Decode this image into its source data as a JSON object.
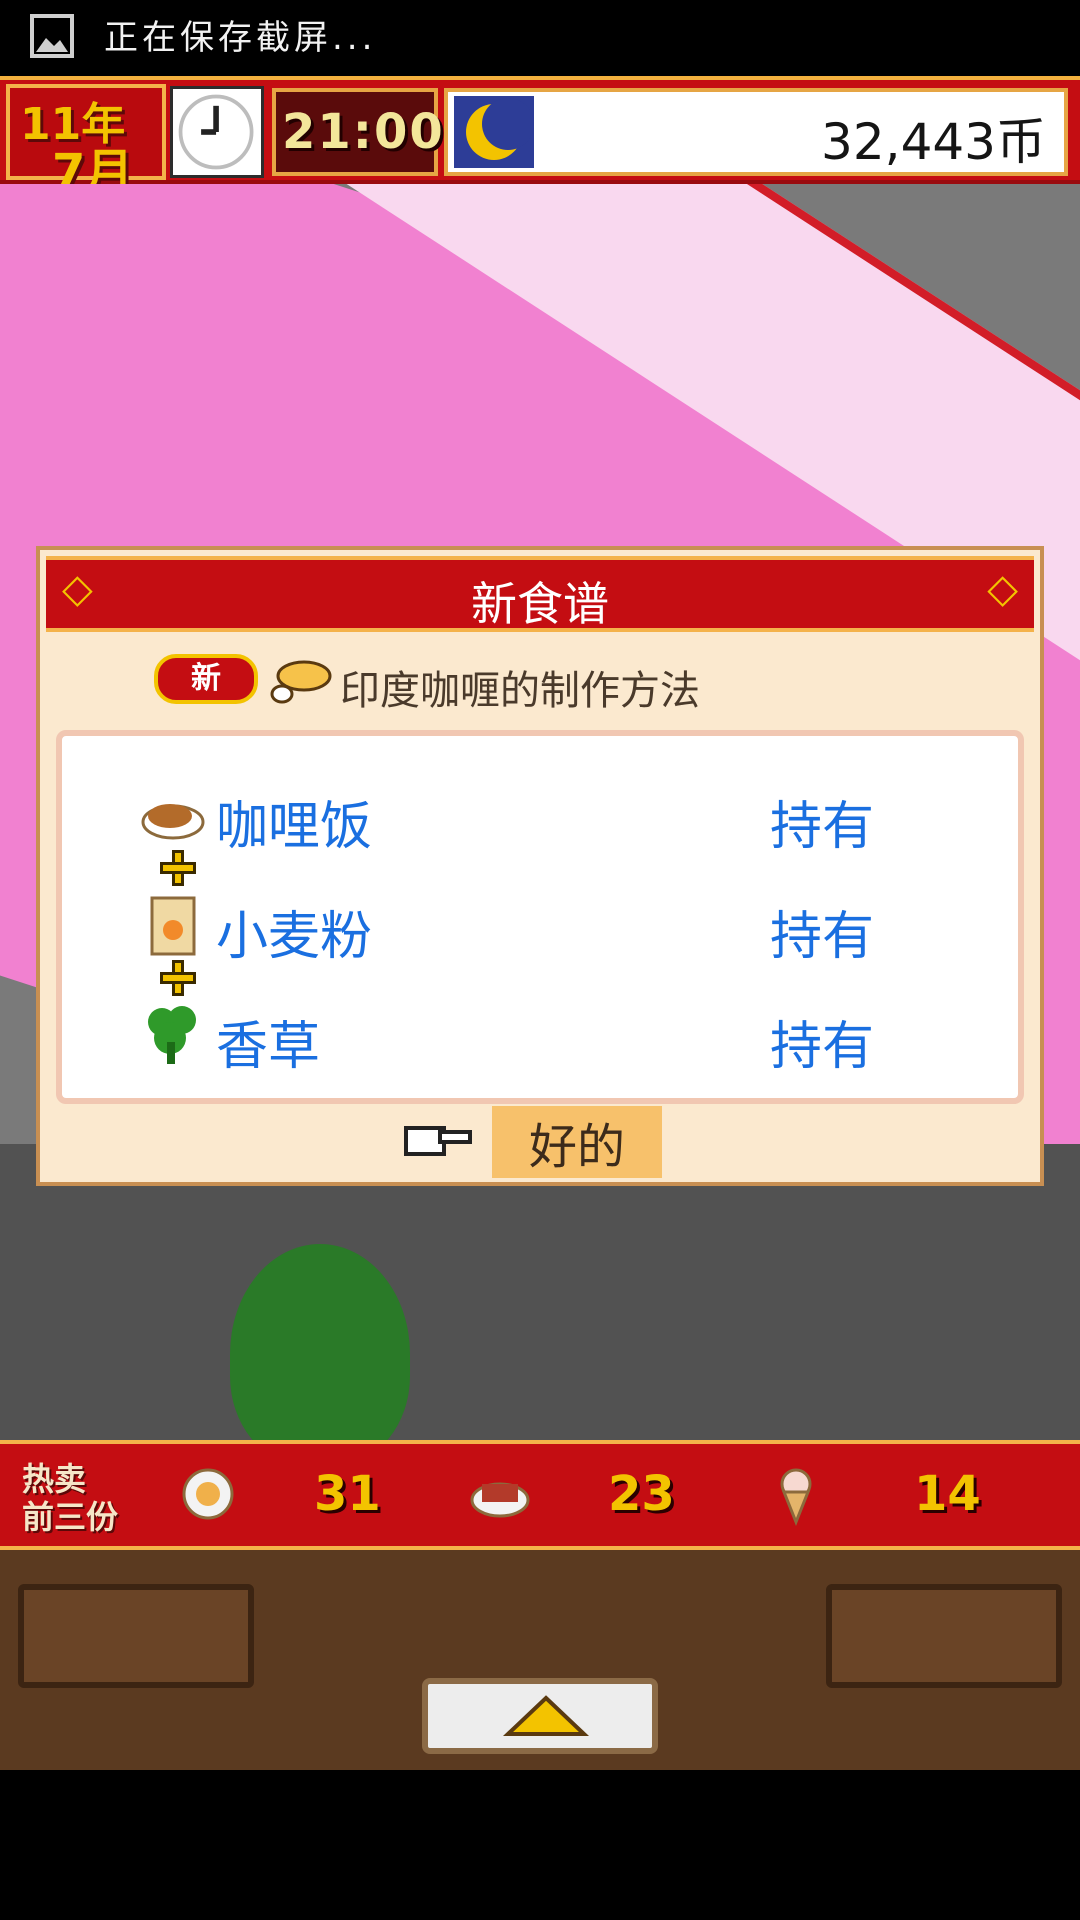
{
  "status_bar": {
    "text": "正在保存截屏..."
  },
  "hud": {
    "year": "11年",
    "month": "7月",
    "time": "21:00",
    "money": "32,443币"
  },
  "dialog": {
    "title": "新食谱",
    "badge": "新",
    "recipe": "印度咖喱的制作方法",
    "items": [
      {
        "name": "咖哩饭",
        "status": "持有",
        "icon": "curry-rice-icon"
      },
      {
        "name": "小麦粉",
        "status": "持有",
        "icon": "flour-bag-icon"
      },
      {
        "name": "香草",
        "status": "持有",
        "icon": "herb-icon"
      }
    ],
    "ok": "好的"
  },
  "ranking": {
    "title_line1": "热卖",
    "title_line2": "前三份",
    "items": [
      {
        "icon": "plate-dish-icon",
        "count": "31"
      },
      {
        "icon": "bbq-dish-icon",
        "count": "23"
      },
      {
        "icon": "ice-cream-icon",
        "count": "14"
      }
    ]
  }
}
